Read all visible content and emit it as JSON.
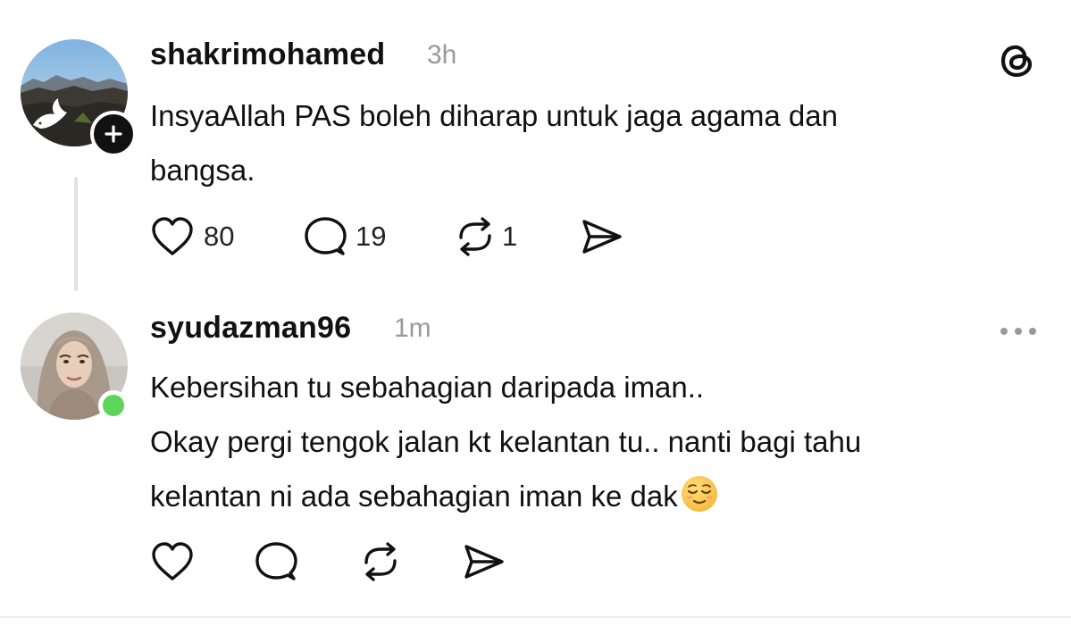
{
  "posts": [
    {
      "username": "shakrimohamed",
      "time": "3h",
      "text_lines": [
        "InsyaAllah PAS boleh diharap untuk jaga agama dan",
        "bangsa."
      ],
      "likes": "80",
      "replies": "19",
      "reposts": "1",
      "avatar": "landscape-dove-avatar",
      "badge": "follow-plus-icon",
      "top_right_icon": "threads-logo-icon"
    },
    {
      "username": "syudazman96",
      "time": "1m",
      "text_lines": [
        "Kebersihan tu sebahagian daripada iman..",
        "Okay pergi tengok jalan kt kelantan tu.. nanti bagi tahu",
        "kelantan ni ada sebahagian iman ke dak"
      ],
      "emoji": "relieved-face",
      "avatar": "hijab-woman-avatar",
      "status": "online",
      "top_right_icon": "more-options-icon"
    }
  ],
  "colors": {
    "text": "#111111",
    "muted": "#9a9a9a",
    "online": "#5dd55b",
    "divider": "#e1e1e1"
  }
}
